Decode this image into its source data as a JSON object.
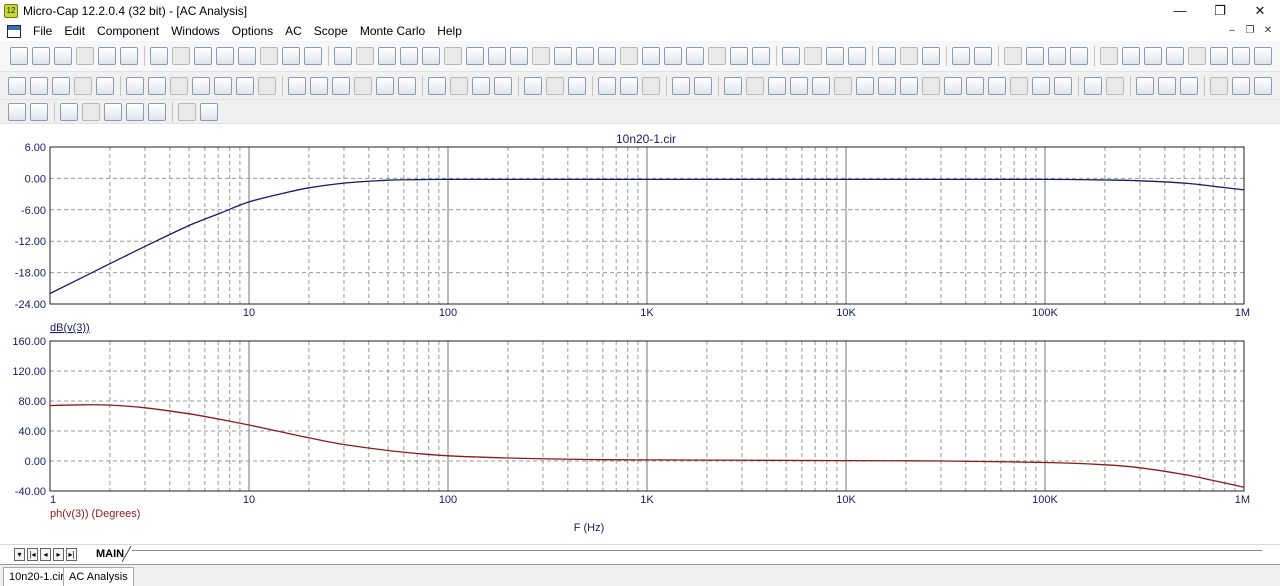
{
  "window": {
    "title": "Micro-Cap 12.2.0.4 (32 bit) - [AC Analysis]",
    "icon_label": "12"
  },
  "menu": {
    "items": [
      "File",
      "Edit",
      "Component",
      "Windows",
      "Options",
      "AC",
      "Scope",
      "Monte Carlo",
      "Help"
    ]
  },
  "chart_data": [
    {
      "type": "line",
      "title": "10n20-1.cir",
      "ylabel": "dB(v(3))",
      "xlabel": "",
      "xscale": "log",
      "xlim": [
        1,
        1000000
      ],
      "ylim": [
        -24,
        6
      ],
      "yticks": [
        "6.00",
        "0.00",
        "-6.00",
        "-12.00",
        "-18.00",
        "-24.00"
      ],
      "xticks": [
        "10",
        "100",
        "1K",
        "10K",
        "100K",
        "1M"
      ],
      "grid": true,
      "series": [
        {
          "color": "#1a1a66",
          "x": [
            1,
            2,
            3,
            5,
            7,
            10,
            15,
            20,
            30,
            50,
            70,
            100,
            1000,
            10000,
            100000,
            200000,
            300000,
            500000,
            700000,
            1000000
          ],
          "y": [
            -22.0,
            -16.3,
            -13.0,
            -9.0,
            -6.8,
            -4.5,
            -2.8,
            -1.8,
            -0.9,
            -0.35,
            -0.25,
            -0.2,
            -0.2,
            -0.2,
            -0.2,
            -0.3,
            -0.45,
            -0.9,
            -1.5,
            -2.2
          ]
        }
      ]
    },
    {
      "type": "line",
      "title": "",
      "ylabel": "ph(v(3)) (Degrees)",
      "xlabel": "F (Hz)",
      "xscale": "log",
      "xlim": [
        1,
        1000000
      ],
      "ylim": [
        -40,
        160
      ],
      "yticks": [
        "160.00",
        "120.00",
        "80.00",
        "40.00",
        "0.00",
        "-40.00"
      ],
      "xticks": [
        "1",
        "10",
        "100",
        "1K",
        "10K",
        "100K",
        "1M"
      ],
      "grid": true,
      "series": [
        {
          "color": "#8b1a1a",
          "x": [
            1,
            1.5,
            2,
            3,
            5,
            7,
            10,
            15,
            20,
            30,
            50,
            70,
            100,
            200,
            500,
            1000,
            10000,
            30000,
            100000,
            200000,
            300000,
            500000,
            700000,
            1000000
          ],
          "y": [
            74,
            75,
            74.5,
            71,
            63,
            56,
            48,
            38,
            31,
            22,
            14,
            10,
            7,
            4,
            2,
            1.5,
            0.5,
            0,
            -2,
            -5,
            -9,
            -18,
            -26,
            -35
          ]
        }
      ]
    }
  ],
  "pagebar": {
    "tab_label": "MAIN",
    "nav_glyphs": [
      "▾",
      "|◂",
      "◂",
      "▸",
      "▸|"
    ]
  },
  "doc_tabs": [
    {
      "label": "10n20-1.cir",
      "active": false
    },
    {
      "label": "AC Analysis",
      "active": true
    }
  ]
}
